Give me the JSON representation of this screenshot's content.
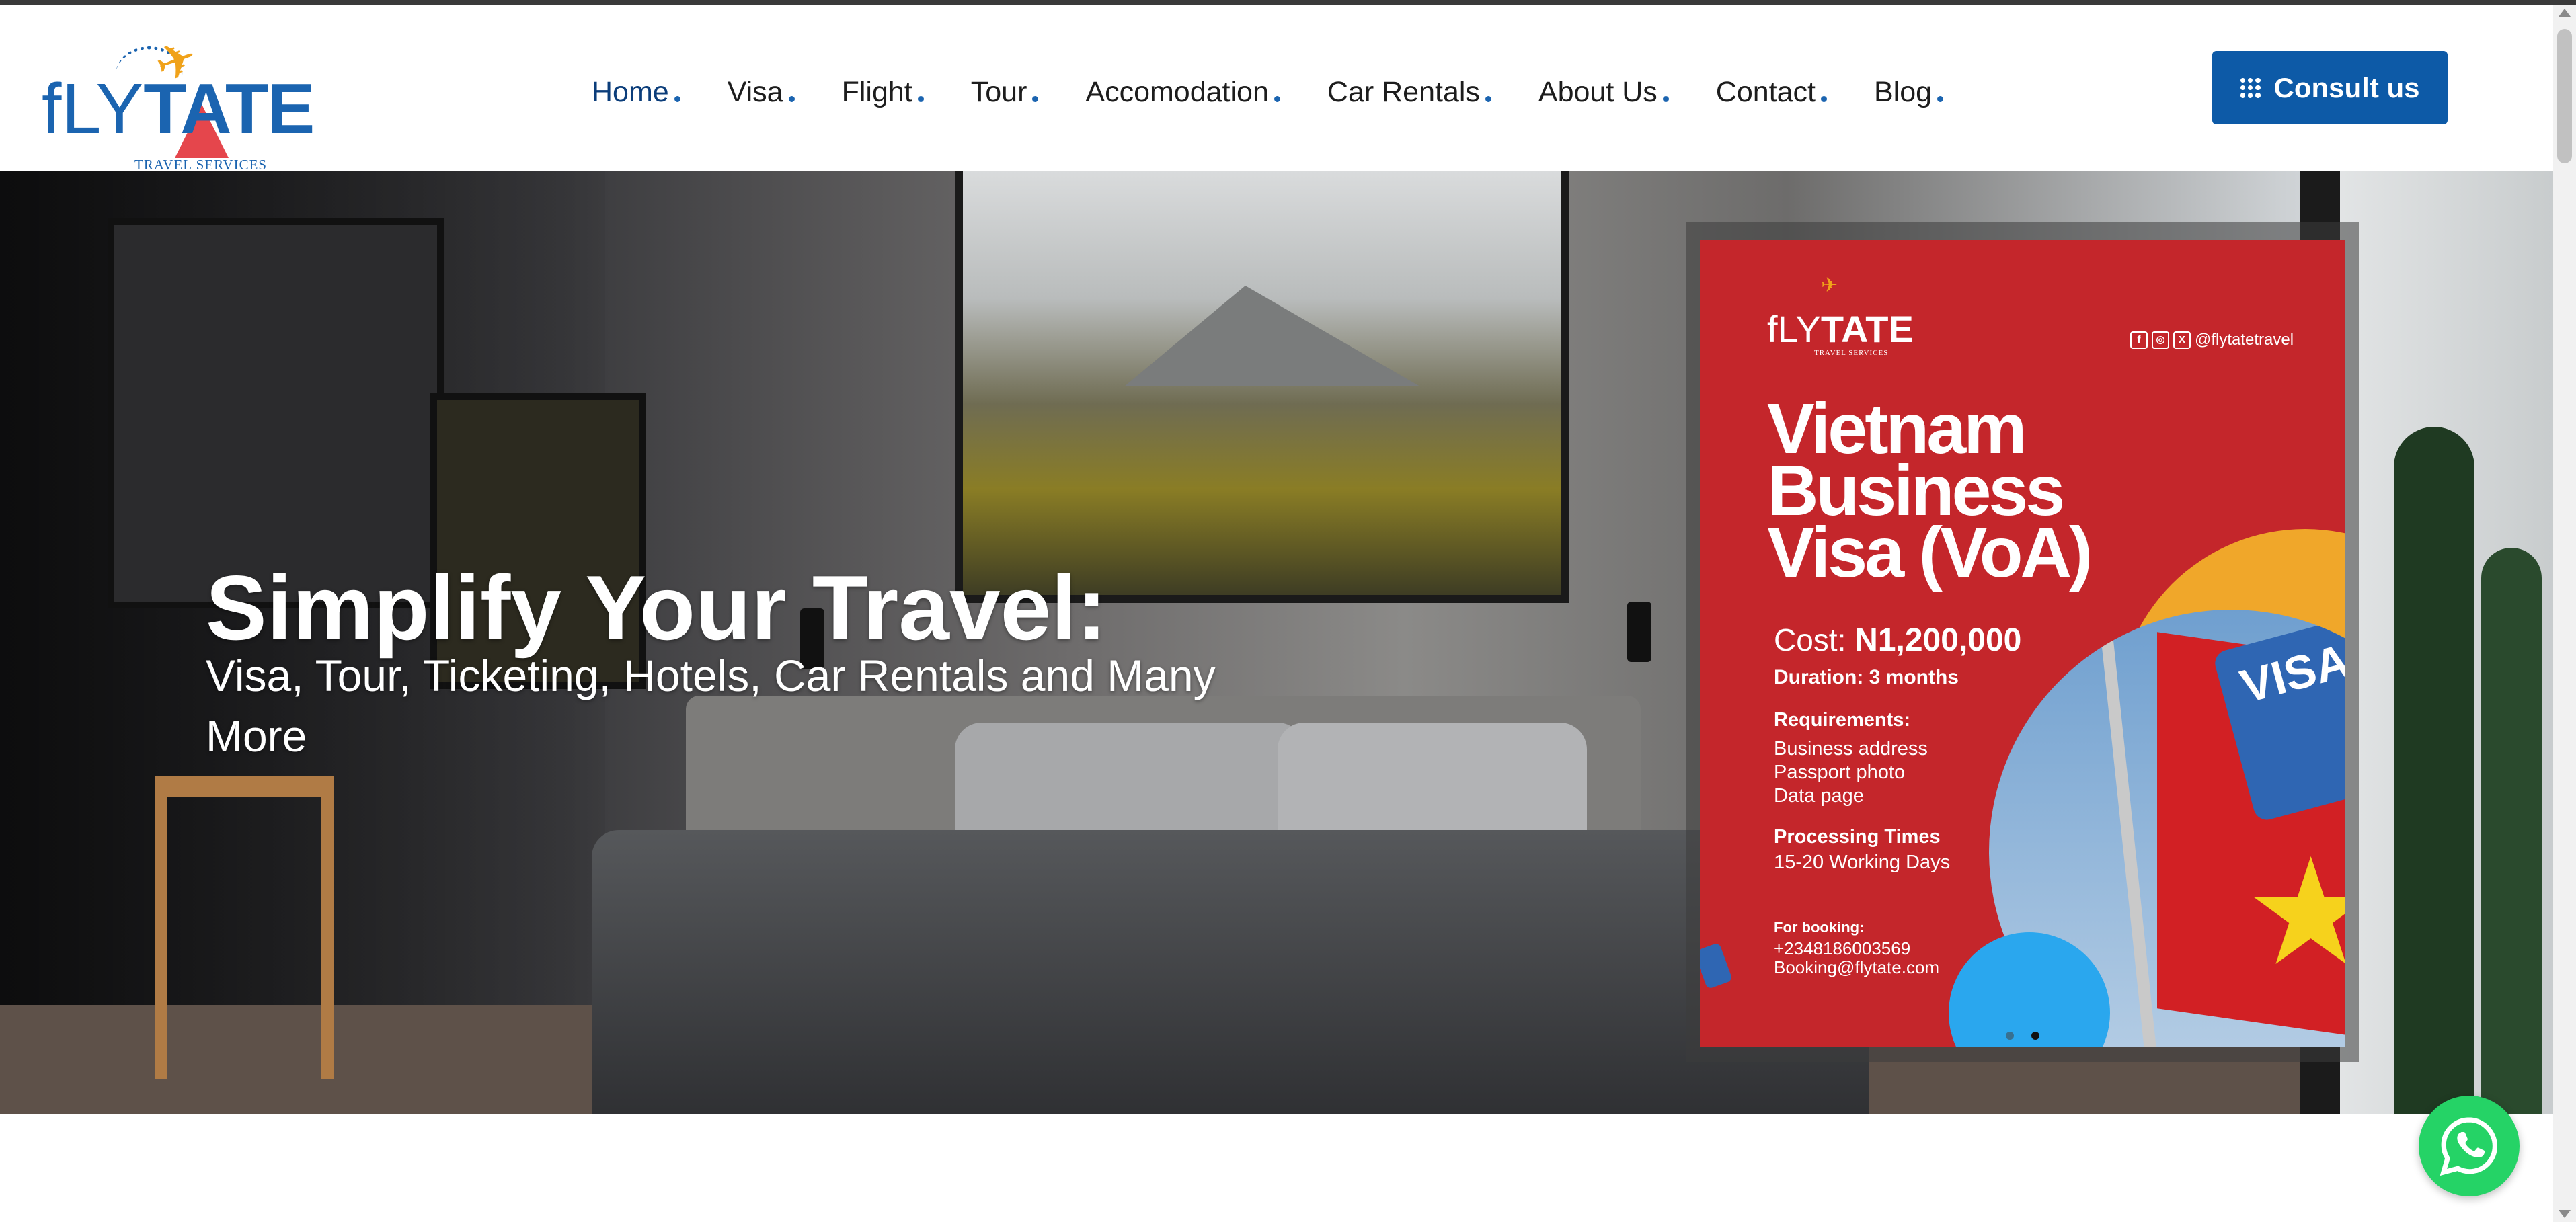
{
  "brand": {
    "name_light": "fLY",
    "name_bold": "TATE",
    "tagline": "TRAVEL SERVICES",
    "primary_color": "#1b64b0",
    "accent_color": "#f0a21a"
  },
  "nav": {
    "items": [
      {
        "label": "Home",
        "active": true
      },
      {
        "label": "Visa",
        "active": false
      },
      {
        "label": "Flight",
        "active": false
      },
      {
        "label": "Tour",
        "active": false
      },
      {
        "label": "Accomodation",
        "active": false
      },
      {
        "label": "Car Rentals",
        "active": false
      },
      {
        "label": "About Us",
        "active": false
      },
      {
        "label": "Contact",
        "active": false
      },
      {
        "label": "Blog",
        "active": false
      }
    ]
  },
  "header": {
    "cta_label": "Consult us",
    "cta_icon": "grid-icon",
    "cta_color": "#0d5aa7"
  },
  "hero": {
    "title": "Simplify Your Travel:",
    "subtitle": "Visa, Tour, Ticketing, Hotels, Car Rentals and Many More"
  },
  "flyer": {
    "logo_light": "fLY",
    "logo_bold": "TATE",
    "logo_tagline": "TRAVEL SERVICES",
    "social_handle": "@flytatetravel",
    "social_icons": [
      "facebook-icon",
      "instagram-icon",
      "x-icon"
    ],
    "headline": "Vietnam Business Visa (VoA)",
    "cost_label": "Cost:",
    "cost_value": "N1,200,000",
    "duration": "Duration: 3 months",
    "requirements_heading": "Requirements:",
    "requirements": [
      "Business address",
      "Passport photo",
      "Data page"
    ],
    "processing_heading": "Processing Times",
    "processing_value": "15-20 Working Days",
    "booking_heading": "For booking:",
    "booking_phone": "+2348186003569",
    "booking_email": "Booking@flytate.com",
    "visa_stamp": "VISA",
    "background_color": "#c4262b"
  },
  "slider": {
    "dots": 2,
    "active_index": 1
  },
  "widgets": {
    "whatsapp_icon": "whatsapp-icon",
    "whatsapp_color": "#25d366"
  }
}
